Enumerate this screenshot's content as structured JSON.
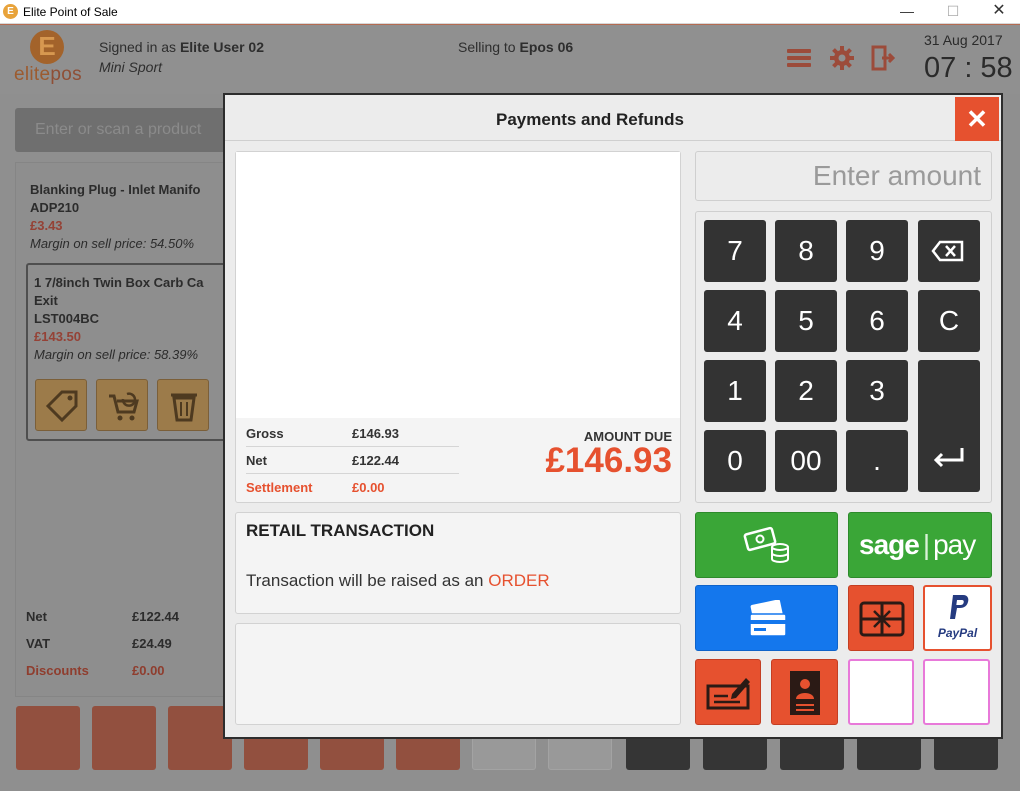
{
  "window": {
    "title": "Elite Point of Sale",
    "icon_letter": "E"
  },
  "header": {
    "logo_letter": "E",
    "logo_text_a": "elite",
    "logo_text_b": "pos",
    "signed_in_prefix": "Signed in as",
    "user": "Elite User 02",
    "store": "Mini Sport",
    "selling_prefix": "Selling to",
    "till": "Epos 06",
    "date": "31 Aug 2017",
    "time": "07 : 58"
  },
  "search": {
    "placeholder": "Enter or scan a product"
  },
  "basket": {
    "items": [
      {
        "name": "Blanking Plug - Inlet Manifo",
        "code": "ADP210",
        "price": "£3.43",
        "margin_label": "Margin on sell price:",
        "margin": "54.50%"
      },
      {
        "name": "1 7/8inch Twin Box Carb Ca",
        "name2": "Exit",
        "code": "LST004BC",
        "price": "£143.50",
        "margin_label": "Margin on sell price:",
        "margin": "58.39%"
      }
    ],
    "totals": [
      {
        "label": "Net",
        "value": "£122.44"
      },
      {
        "label": "VAT",
        "value": "£24.49"
      },
      {
        "label": "Discounts",
        "value": "£0.00"
      }
    ]
  },
  "modal": {
    "title": "Payments and Refunds",
    "close": "✕",
    "summary": [
      {
        "label": "Gross",
        "value": "£146.93"
      },
      {
        "label": "Net",
        "value": "£122.44"
      },
      {
        "label": "Settlement",
        "value": "£0.00"
      }
    ],
    "amount_due_label": "AMOUNT DUE",
    "amount_due": "£146.93",
    "transaction_title": "RETAIL TRANSACTION",
    "transaction_text": "Transaction will be raised as an",
    "transaction_type": "ORDER",
    "amount_placeholder": "Enter amount",
    "keys": [
      "7",
      "8",
      "9",
      "4",
      "5",
      "6",
      "C",
      "1",
      "2",
      "3",
      "0",
      "00",
      "."
    ],
    "sage_text_a": "sage",
    "sage_text_b": "pay",
    "paypal_text": "PayPal"
  },
  "colors": {
    "accent": "#e6512f",
    "cash": "#3aa637",
    "card": "#1477ed",
    "paypal_blue": "#253b80"
  }
}
